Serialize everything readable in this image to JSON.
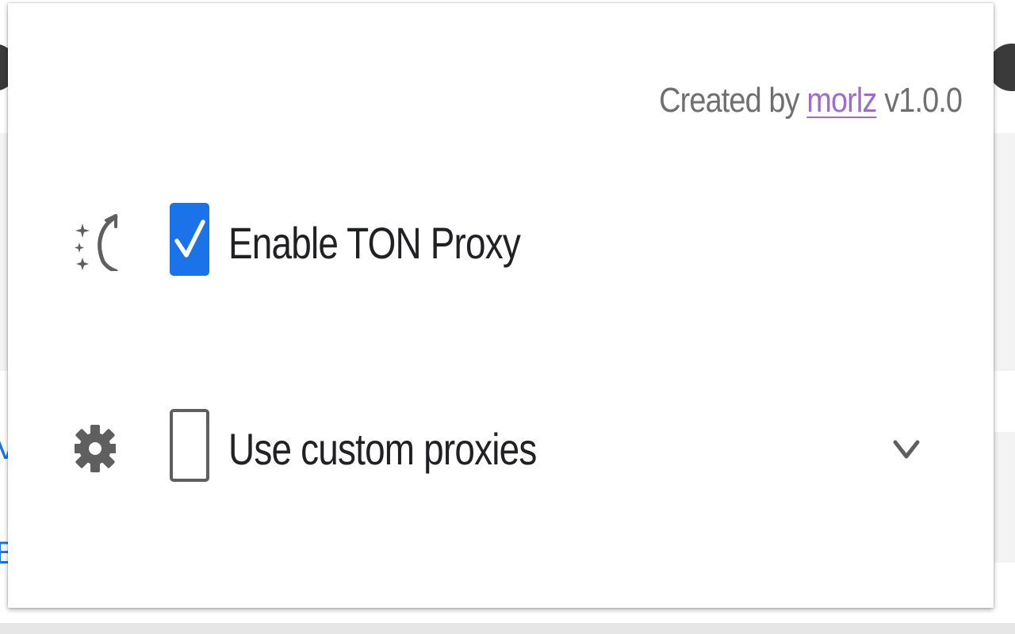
{
  "credits": {
    "prefix": "Created by ",
    "author": "morlz",
    "version": " v1.0.0"
  },
  "options": [
    {
      "label": "Enable TON Proxy",
      "checked": true,
      "icon": "magic-wand-sparkle-icon"
    },
    {
      "label": "Use custom proxies",
      "checked": false,
      "icon": "gear-icon",
      "expand_icon": "chevron-down-icon"
    }
  ],
  "colors": {
    "accent": "#1a73e8",
    "link": "#9b6fc9",
    "muted_text": "#6f6f6f",
    "icon": "#5f5f5f"
  },
  "background_page": {
    "glyph_1": "V",
    "glyph_2": "B"
  }
}
